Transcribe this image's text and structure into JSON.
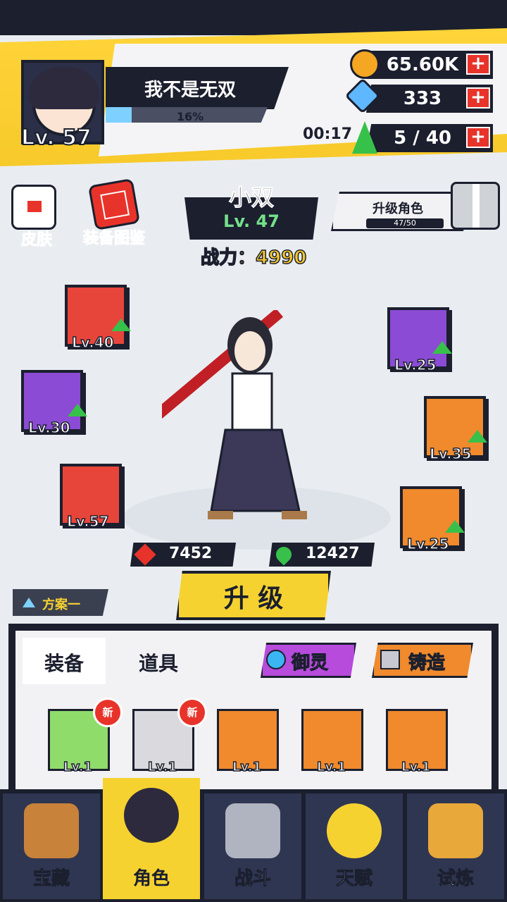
{
  "player": {
    "name": "我不是无双",
    "level": "Lv. 57",
    "exp_percent": "16%",
    "exp_fraction": 0.16
  },
  "resources": {
    "gold": "65.60K",
    "gem": "333",
    "energy": "5 / 40",
    "energy_timer": "00:17",
    "plus": "+"
  },
  "side_buttons": {
    "skin": "皮肤",
    "equip_gallery": "装备图鉴"
  },
  "hero": {
    "name": "小双",
    "level": "Lv. 47",
    "power_label": "战力：",
    "power_value": "4990",
    "upgrade_label": "升级角色",
    "upgrade_progress": "47/50",
    "upgrade_fraction": 0.94,
    "attack": "7452",
    "hp": "12427"
  },
  "equipment": [
    {
      "slot": "book",
      "level": "Lv.40"
    },
    {
      "slot": "ring",
      "level": "Lv.30"
    },
    {
      "slot": "weapon",
      "level": "Lv.57"
    },
    {
      "slot": "helmet",
      "level": "Lv.25"
    },
    {
      "slot": "armor",
      "level": "Lv.35"
    },
    {
      "slot": "boots",
      "level": "Lv.25"
    }
  ],
  "upgrade_button": "升 级",
  "plan": "方案一",
  "bag": {
    "tab_equip": "装备",
    "tab_items": "道具",
    "spirit": "御灵",
    "forge": "铸造",
    "new_badge": "新",
    "items": [
      {
        "name": "ring-item",
        "level": "Lv.1",
        "is_new": true
      },
      {
        "name": "uniform-item",
        "level": "Lv.1",
        "is_new": true
      },
      {
        "name": "blade-item",
        "level": "Lv.1",
        "is_new": false
      },
      {
        "name": "gem-necklace-item",
        "level": "Lv.1",
        "is_new": false
      },
      {
        "name": "robe-item",
        "level": "Lv.1",
        "is_new": false
      }
    ]
  },
  "nav": {
    "treasure": "宝藏",
    "role": "角色",
    "battle": "战斗",
    "talent": "天赋",
    "trial": "试炼"
  },
  "colors": {
    "accent_yellow": "#f6d230",
    "dark": "#1b1f2e",
    "green": "#37c14a",
    "red": "#e8332b"
  }
}
